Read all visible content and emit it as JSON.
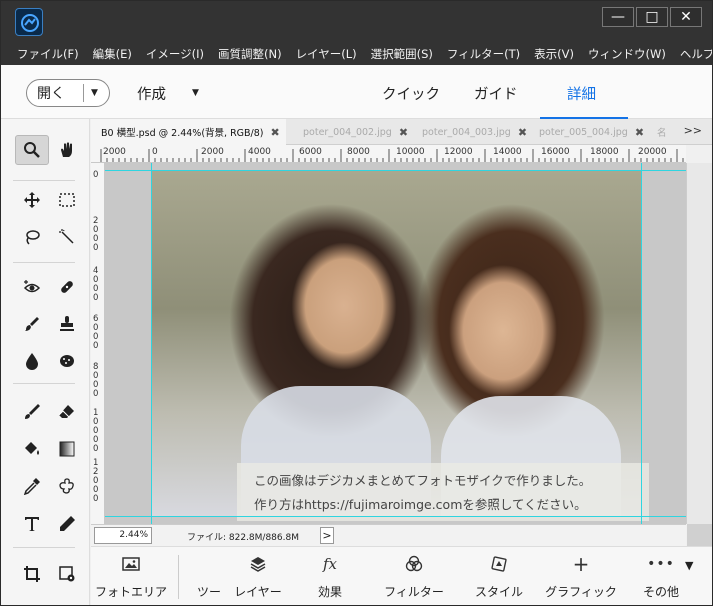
{
  "menu": [
    "ファイル(F)",
    "編集(E)",
    "イメージ(I)",
    "画質調整(N)",
    "レイヤー(L)",
    "選択範囲(S)",
    "フィルター(T)",
    "表示(V)",
    "ウィンドウ(W)",
    "ヘルプ(H)"
  ],
  "window_buttons": {
    "minimize": "—",
    "restore": "□",
    "close": "✕"
  },
  "modebar": {
    "open_label": "開く",
    "create_label": "作成",
    "quick": "クイック",
    "guide": "ガイド",
    "expert": "詳細"
  },
  "tabs": [
    {
      "label": "B0 横型.psd @ 2.44%(背景, RGB/8)",
      "active": true
    },
    {
      "label": "poter_004_002.jpg",
      "active": false
    },
    {
      "label": "poter_004_003.jpg",
      "active": false
    },
    {
      "label": "poter_005_004.jpg",
      "active": false
    },
    {
      "label": "名",
      "active": false
    }
  ],
  "tabs_more": ">>",
  "ruler_top": [
    "2000",
    "0",
    "2000",
    "4000",
    "6000",
    "8000",
    "10000",
    "12000",
    "14000",
    "16000",
    "18000",
    "20000"
  ],
  "ruler_left": [
    {
      "chars": [
        "0"
      ]
    },
    {
      "chars": [
        "2",
        "0",
        "0",
        "0"
      ]
    },
    {
      "chars": [
        "4",
        "0",
        "0",
        "0"
      ]
    },
    {
      "chars": [
        "6",
        "0",
        "0",
        "0"
      ]
    },
    {
      "chars": [
        "8",
        "0",
        "0",
        "0"
      ]
    },
    {
      "chars": [
        "1",
        "0",
        "0",
        "0",
        "0"
      ]
    },
    {
      "chars": [
        "1",
        "2",
        "0",
        "0",
        "0"
      ]
    }
  ],
  "caption": {
    "line1": "この画像はデジカメまとめてフォトモザイクで作りました。",
    "line2": "作り方はhttps://fujimaroimge.comを参照してください。"
  },
  "status": {
    "zoom": "2.44%",
    "file_info": "ファイル: 822.8M/886.8M",
    "arrow": ">"
  },
  "panels": [
    "フォトエリア",
    "ツー",
    "レイヤー",
    "効果",
    "フィルター",
    "スタイル",
    "グラフィック",
    "その他"
  ],
  "panel_icons": [
    "photo-icon",
    "layers-icon",
    "fx-icon",
    "filter-icon",
    "style-icon",
    "plus-icon",
    "more-icon"
  ],
  "accent_color": "#1473e6",
  "guide_color": "#2fd5e0"
}
